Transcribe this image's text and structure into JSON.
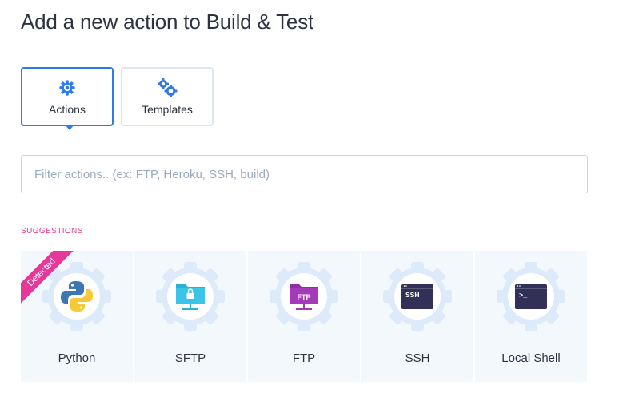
{
  "page": {
    "title": "Add a new action to Build & Test"
  },
  "tabs": [
    {
      "label": "Actions",
      "icon": "gear-icon",
      "active": true
    },
    {
      "label": "Templates",
      "icon": "gears-icon",
      "active": false
    }
  ],
  "filter": {
    "placeholder": "Filter actions.. (ex: FTP, Heroku, SSH, build)",
    "value": ""
  },
  "suggestions": {
    "label": "SUGGESTIONS",
    "items": [
      {
        "label": "Python",
        "icon": "python-icon",
        "badge": "Detected"
      },
      {
        "label": "SFTP",
        "icon": "sftp-folder-icon"
      },
      {
        "label": "FTP",
        "icon": "ftp-folder-icon"
      },
      {
        "label": "SSH",
        "icon": "ssh-terminal-icon",
        "icon_text": "SSH"
      },
      {
        "label": "Local Shell",
        "icon": "local-shell-terminal-icon",
        "icon_text": ">_"
      }
    ]
  },
  "colors": {
    "accent": "#2f7be5",
    "badge": "#e8379a",
    "suggestion_label": "#e0388a",
    "card_bg": "#f3f8fd",
    "python_blue": "#3d76b0",
    "python_yellow": "#f7c83a",
    "sftp_teal": "#2bb0d8",
    "ftp_purple": "#a43ab8",
    "terminal_navy": "#333058"
  }
}
